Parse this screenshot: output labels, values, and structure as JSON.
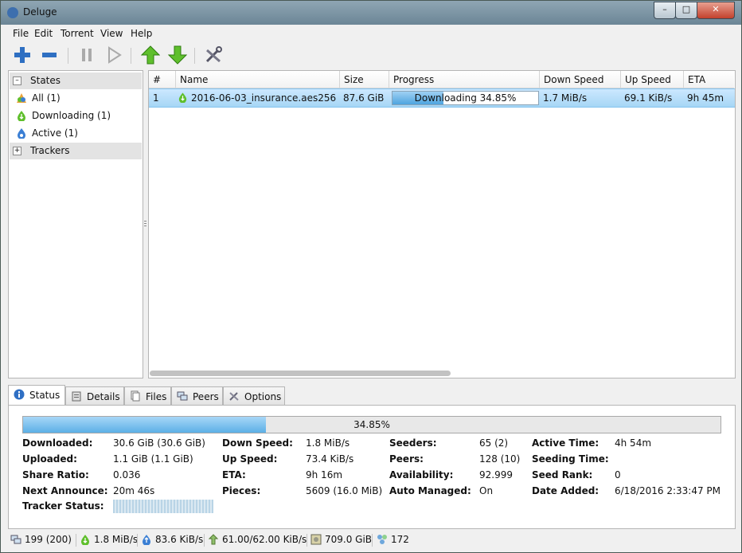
{
  "window": {
    "title": "Deluge",
    "min": "–",
    "max": "□",
    "close": "✕"
  },
  "menu": [
    "File",
    "Edit",
    "Torrent",
    "View",
    "Help"
  ],
  "toolbar": {
    "icons": [
      "add-torrent-icon",
      "remove-torrent-icon",
      "pause-icon",
      "resume-icon",
      "queue-up-icon",
      "queue-down-icon",
      "preferences-icon"
    ]
  },
  "sidebar": {
    "states_label": "States",
    "states_expander": "–",
    "items": [
      {
        "label": "All (1)",
        "icon": "all-icon"
      },
      {
        "label": "Downloading (1)",
        "icon": "downloading-icon"
      },
      {
        "label": "Active (1)",
        "icon": "active-icon"
      }
    ],
    "trackers_label": "Trackers",
    "trackers_expander": "+"
  },
  "torrent_list": {
    "columns": [
      "#",
      "Name",
      "Size",
      "Progress",
      "Down Speed",
      "Up Speed",
      "ETA"
    ],
    "rows": [
      {
        "index": "1",
        "name": "2016-06-03_insurance.aes256",
        "size": "87.6 GiB",
        "progress_text": "Downloading 34.85%",
        "progress_fraction": 0.3485,
        "down_speed": "1.7 MiB/s",
        "up_speed": "69.1 KiB/s",
        "eta": "9h 45m"
      }
    ]
  },
  "tabs": [
    {
      "label": "Status",
      "active": true
    },
    {
      "label": "Details",
      "active": false
    },
    {
      "label": "Files",
      "active": false
    },
    {
      "label": "Peers",
      "active": false
    },
    {
      "label": "Options",
      "active": false
    }
  ],
  "status_panel": {
    "progress_text": "34.85%",
    "progress_fraction": 0.3485,
    "fields": {
      "downloaded": {
        "label": "Downloaded:",
        "value": "30.6 GiB (30.6 GiB)"
      },
      "uploaded": {
        "label": "Uploaded:",
        "value": "1.1 GiB (1.1 GiB)"
      },
      "share_ratio": {
        "label": "Share Ratio:",
        "value": "0.036"
      },
      "next_announce": {
        "label": "Next Announce:",
        "value": "20m 46s"
      },
      "tracker_status": {
        "label": "Tracker Status:",
        "value": ""
      },
      "down_speed": {
        "label": "Down Speed:",
        "value": "1.8 MiB/s"
      },
      "up_speed": {
        "label": "Up Speed:",
        "value": "73.4 KiB/s"
      },
      "eta": {
        "label": "ETA:",
        "value": "9h 16m"
      },
      "pieces": {
        "label": "Pieces:",
        "value": "5609 (16.0 MiB)"
      },
      "seeders": {
        "label": "Seeders:",
        "value": "65 (2)"
      },
      "peers": {
        "label": "Peers:",
        "value": "128 (10)"
      },
      "availability": {
        "label": "Availability:",
        "value": "92.999"
      },
      "auto_managed": {
        "label": "Auto Managed:",
        "value": "On"
      },
      "active_time": {
        "label": "Active Time:",
        "value": "4h 54m"
      },
      "seeding_time": {
        "label": "Seeding Time:",
        "value": ""
      },
      "seed_rank": {
        "label": "Seed Rank:",
        "value": "0"
      },
      "date_added": {
        "label": "Date Added:",
        "value": "6/18/2016 2:33:47 PM"
      }
    }
  },
  "statusbar": {
    "connections": "199 (200)",
    "download_speed": "1.8 MiB/s",
    "upload_speed": "83.6 KiB/s",
    "protocol_traffic": "61.00/62.00 KiB/s",
    "free_space": "709.0 GiB",
    "dht_nodes": "172"
  }
}
